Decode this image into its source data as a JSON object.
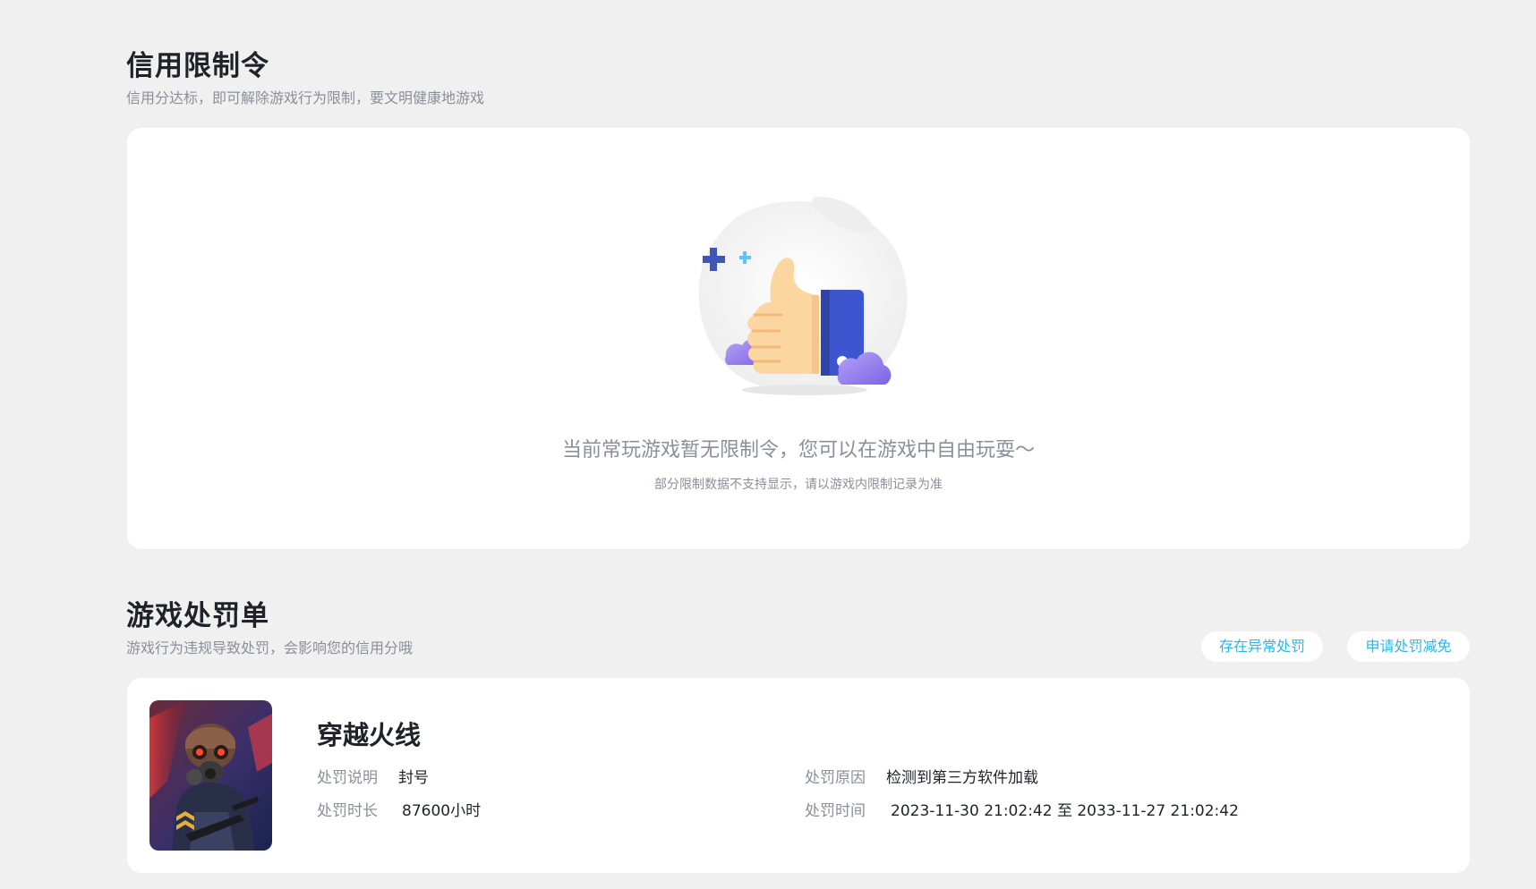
{
  "credit": {
    "title": "信用限制令",
    "subtitle": "信用分达标，即可解除游戏行为限制，要文明健康地游戏",
    "empty_message": "当前常玩游戏暂无限制令，您可以在游戏中自由玩耍～",
    "empty_note": "部分限制数据不支持显示，请以游戏内限制记录为准"
  },
  "penalty": {
    "title": "游戏处罚单",
    "subtitle": "游戏行为违规导致处罚，会影响您的信用分哦",
    "actions": {
      "abnormal_label": "存在异常处罚",
      "appeal_label": "申请处罚减免"
    },
    "record": {
      "game_name": "穿越火线",
      "desc_label": "处罚说明",
      "desc_value": "封号",
      "duration_label": "处罚时长",
      "duration_value": "87600小时",
      "reason_label": "处罚原因",
      "reason_value": "检测到第三方软件加载",
      "time_label": "处罚时间",
      "time_value": "2023-11-30 21:02:42 至 2033-11-27 21:02:42"
    }
  },
  "colors": {
    "background": "#f0f0f0",
    "card": "#ffffff",
    "accent": "#2bb6e8",
    "title": "#1f2329",
    "muted": "#8a8f99"
  },
  "icons": {
    "empty_illustration": "thumbs-up-illustration",
    "game_cover": "crossfire-soldier-cover"
  }
}
